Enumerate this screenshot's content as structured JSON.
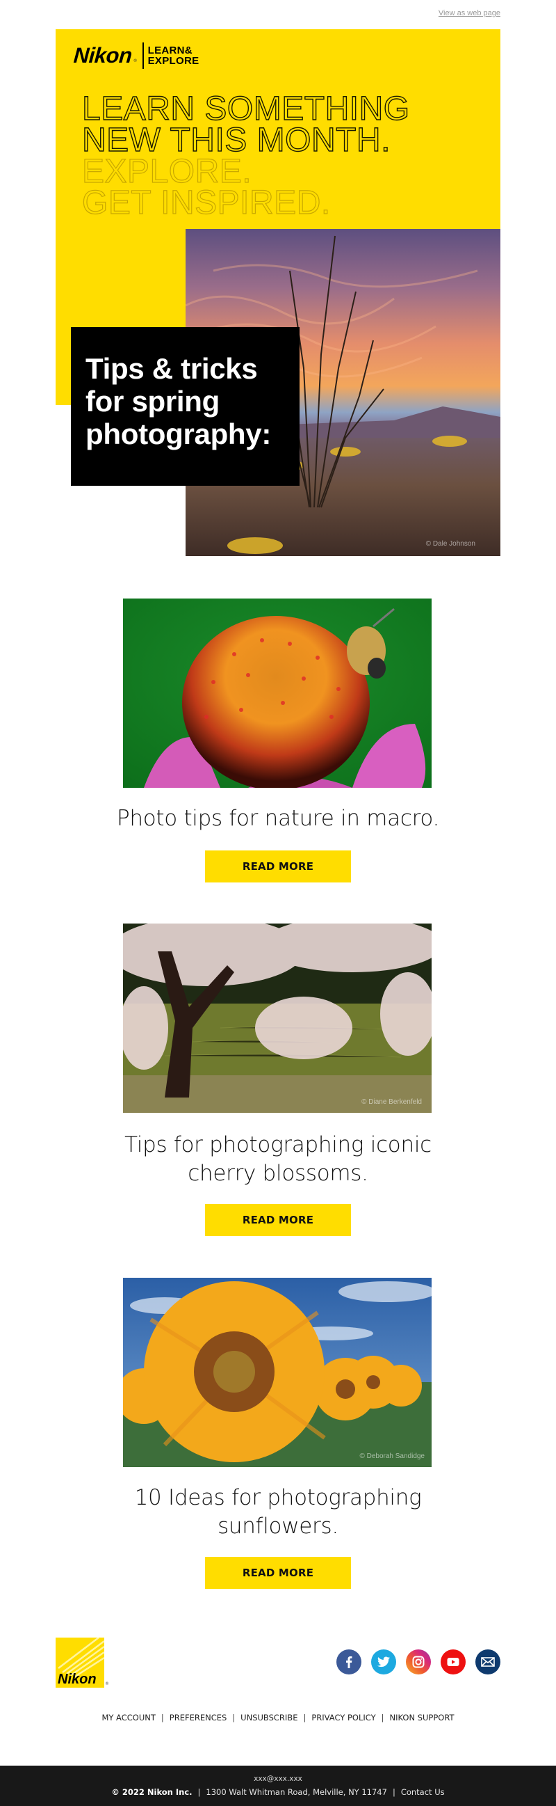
{
  "topbar": {
    "view_web_label": "View as web page"
  },
  "brand": {
    "logo_word": "Nikon",
    "registered": "®",
    "sub_line1": "LEARN&",
    "sub_line2": "EXPLORE",
    "accent_color": "#ffdd00"
  },
  "hero": {
    "headline_lines": [
      "LEARN SOMETHING",
      "NEW THIS MONTH.",
      "EXPLORE.",
      "GET INSPIRED."
    ],
    "black_box_lines": [
      "Tips & tricks",
      "for spring",
      "photography:"
    ],
    "photo_alt": "Desert ocotillo at sunset",
    "photo_credit": "© Dale Johnson"
  },
  "articles": [
    {
      "image_alt": "Bee on coneflower macro",
      "title": "Photo tips for nature in macro.",
      "button_label": "READ MORE"
    },
    {
      "image_alt": "Weeping cherry tree by pond",
      "title": "Tips for photographing iconic cherry blossoms.",
      "title_lines": [
        "Tips for photographing iconic",
        "cherry blossoms."
      ],
      "photo_credit": "© Diane Berkenfeld",
      "button_label": "READ MORE"
    },
    {
      "image_alt": "Sunflower field",
      "title": "10 Ideas for photographing sunflowers.",
      "title_lines": [
        "10 Ideas for photographing",
        "sunflowers."
      ],
      "photo_credit": "© Deborah Sandidge",
      "button_label": "READ MORE"
    }
  ],
  "footer": {
    "logo_word": "Nikon",
    "registered": "®",
    "social": [
      {
        "name": "facebook",
        "icon": "facebook-icon",
        "color": "#3b5998"
      },
      {
        "name": "twitter",
        "icon": "twitter-icon",
        "color": "#1da1f2"
      },
      {
        "name": "instagram",
        "icon": "instagram-icon",
        "color": "#e1306c"
      },
      {
        "name": "youtube",
        "icon": "youtube-icon",
        "color": "#ff0000"
      },
      {
        "name": "email",
        "icon": "mail-icon",
        "color": "#0e3a6e"
      }
    ],
    "links": [
      "MY ACCOUNT",
      "PREFERENCES",
      "UNSUBSCRIBE",
      "PRIVACY POLICY",
      "NIKON SUPPORT"
    ],
    "separator": "|",
    "email": "xxx@xxx.xxx",
    "copyright": "© 2022 Nikon Inc.",
    "address": "1300 Walt Whitman Road, Melville, NY 11747",
    "contact_label": "Contact Us"
  }
}
